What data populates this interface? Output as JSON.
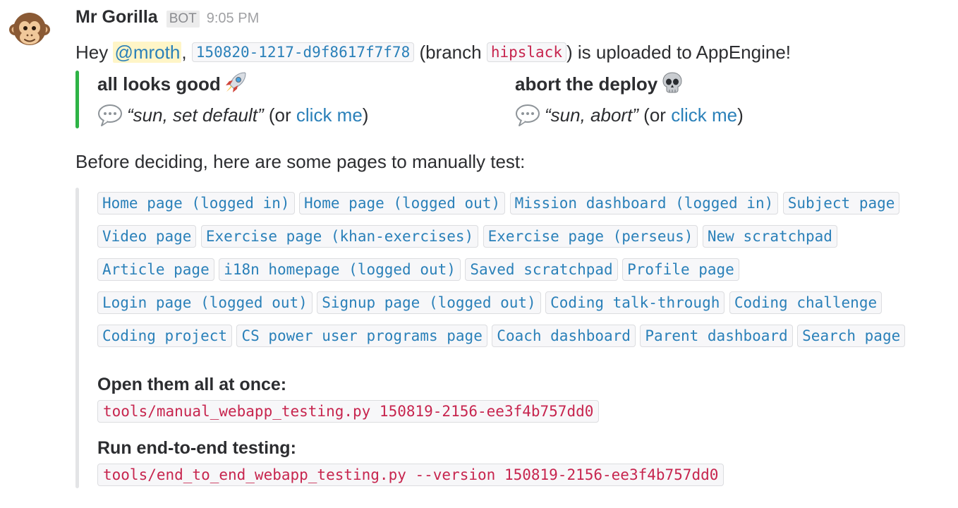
{
  "message": {
    "author": "Mr Gorilla",
    "bot_badge": "BOT",
    "timestamp": "9:05 PM",
    "avatar_icon": "monkey-face-icon",
    "text": {
      "greeting": "Hey ",
      "mention": "@mroth",
      "comma": ", ",
      "version": "150820-1217-d9f8617f7f78",
      "branch_prefix": " (branch ",
      "branch": "hipslack",
      "suffix": ") is uploaded to AppEngine!"
    }
  },
  "choices": {
    "accent_color": "#2eb346",
    "good": {
      "title": "all looks good",
      "icon": "rocket-icon",
      "command": "“sun, set default”",
      "or_text": " (or ",
      "link": "click me",
      "close": ")"
    },
    "abort": {
      "title": "abort the deploy",
      "icon": "skull-icon",
      "command": "“sun, abort”",
      "or_text": " (or ",
      "link": "click me",
      "close": ")"
    }
  },
  "testing": {
    "intro": "Before deciding, here are some pages to manually test:",
    "pages": [
      "Home page (logged in)",
      "Home page (logged out)",
      "Mission dashboard (logged in)",
      "Subject page",
      "Video page",
      "Exercise page (khan-exercises)",
      "Exercise page (perseus)",
      "New scratchpad",
      "Article page",
      "i18n homepage (logged out)",
      "Saved scratchpad",
      "Profile page",
      "Login page (logged out)",
      "Signup page (logged out)",
      "Coding talk-through",
      "Coding challenge",
      "Coding project",
      "CS power user programs page",
      "Coach dashboard",
      "Parent dashboard",
      "Search page"
    ],
    "open_all_title": "Open them all at once:",
    "open_all_cmd": "tools/manual_webapp_testing.py 150819-2156-ee3f4b757dd0",
    "e2e_title": "Run end-to-end testing:",
    "e2e_cmd": "tools/end_to_end_webapp_testing.py --version 150819-2156-ee3f4b757dd0"
  }
}
